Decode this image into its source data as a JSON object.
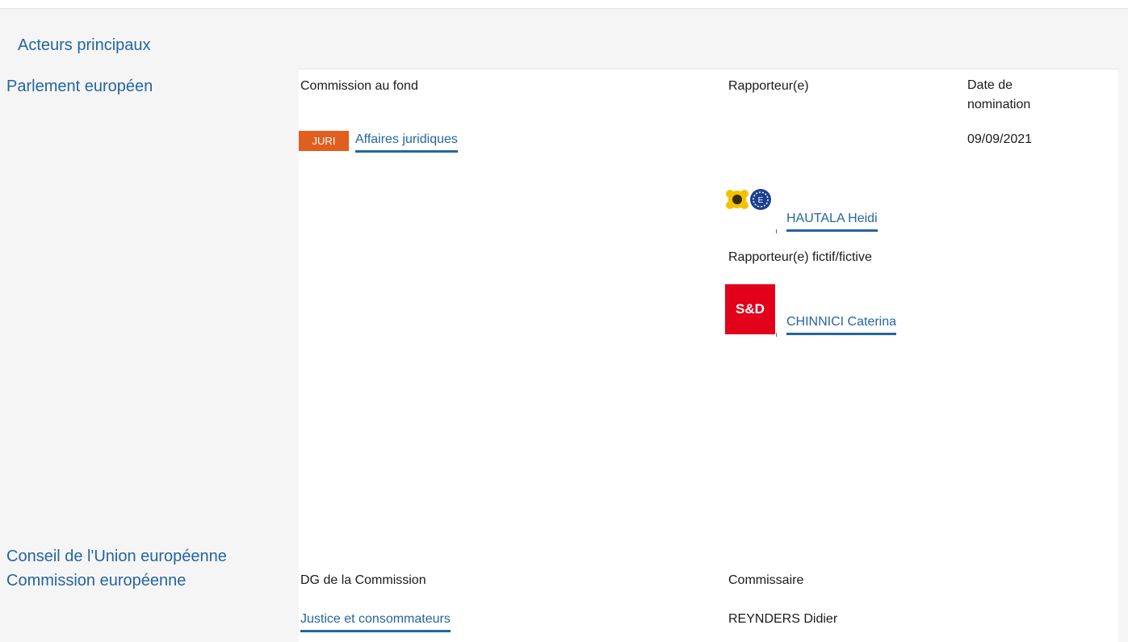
{
  "section": {
    "title": "Acteurs principaux"
  },
  "parliament": {
    "institution": "Parlement européen",
    "col_committee_header": "Commission au fond",
    "col_rapporteur_header": "Rapporteur(e)",
    "col_date_header": "Date de nomination",
    "committee": {
      "badge": "JURI",
      "name": "Affaires juridiques"
    },
    "date": "09/09/2021",
    "rapporteur": {
      "name": "HAUTALA Heidi",
      "group_icon": "greens-efa-logo-icon"
    },
    "shadow_label": "Rapporteur(e) fictif/fictive",
    "shadow": {
      "name": "CHINNICI Caterina",
      "group_logo_text": "S&D"
    }
  },
  "council": {
    "institution": "Conseil de l'Union européenne"
  },
  "commission": {
    "institution": "Commission européenne",
    "col_dg_header": "DG de la Commission",
    "col_commissioner_header": "Commissaire",
    "dg": "Justice et consommateurs",
    "commissioner": "REYNDERS Didier"
  },
  "colors": {
    "accent": "#2465a0",
    "badge": "#e05e1e",
    "sd_red": "#e2001a",
    "panel_gray": "#f5f5f5"
  }
}
